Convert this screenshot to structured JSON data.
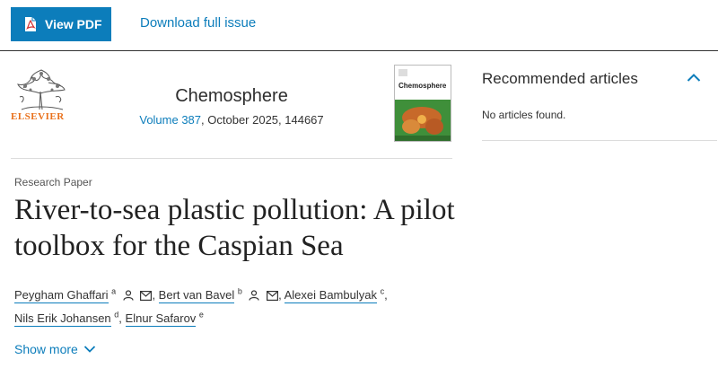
{
  "toolbar": {
    "view_pdf_label": "View PDF",
    "download_label": "Download full issue"
  },
  "journal": {
    "publisher": "ELSEVIER",
    "title": "Chemosphere",
    "volume_link": "Volume 387",
    "issue_info": ", October 2025, 144667",
    "cover_title": "Chemosphere"
  },
  "article": {
    "type": "Research Paper",
    "title": "River-to-sea plastic pollution: A pilot toolbox for the Caspian Sea",
    "authors": [
      {
        "name": "Peygham Ghaffari",
        "sup": "a"
      },
      {
        "name": "Bert van Bavel",
        "sup": "b"
      },
      {
        "name": "Alexei Bambulyak",
        "sup": "c"
      },
      {
        "name": "Nils Erik Johansen",
        "sup": "d"
      },
      {
        "name": "Elnur Safarov",
        "sup": "e"
      }
    ],
    "show_more_label": "Show more"
  },
  "recommended": {
    "title": "Recommended articles",
    "empty_text": "No articles found."
  },
  "colors": {
    "accent": "#0c7dbb",
    "elsevier_orange": "#e9711c"
  }
}
